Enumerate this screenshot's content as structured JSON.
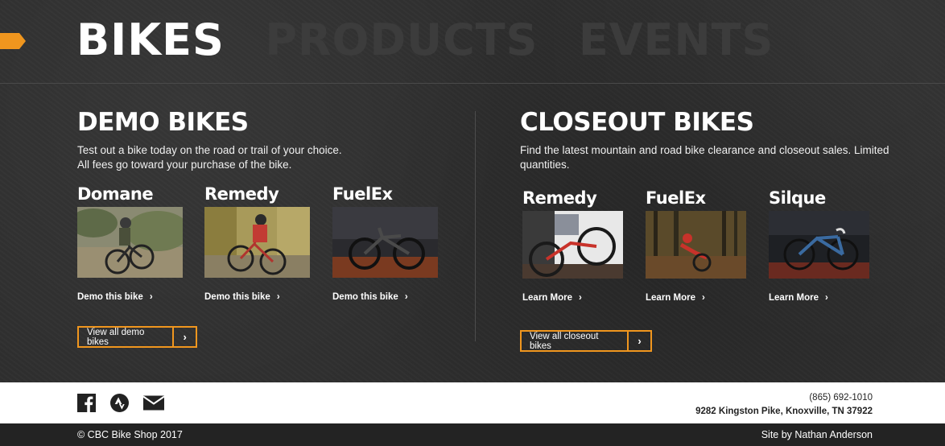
{
  "nav": {
    "tabs": [
      {
        "label": "BIKES",
        "active": true
      },
      {
        "label": "PRODUCTS",
        "active": false
      },
      {
        "label": "EVENTS",
        "active": false
      }
    ],
    "marker_color": "#f0961e"
  },
  "demo": {
    "title": "DEMO BIKES",
    "desc_line1": "Test out a bike today on the road or trail of your choice.",
    "desc_line2": "All fees go toward your purchase of the bike.",
    "bikes": [
      {
        "name": "Domane",
        "link": "Demo this bike"
      },
      {
        "name": "Remedy",
        "link": "Demo this bike"
      },
      {
        "name": "FuelEx",
        "link": "Demo this bike"
      }
    ],
    "view_all": "View all demo bikes"
  },
  "closeout": {
    "title": "CLOSEOUT BIKES",
    "desc_line1": "Find the latest mountain and road bike clearance and closeout sales. Limited",
    "desc_line2": "quantities.",
    "bikes": [
      {
        "name": "Remedy",
        "link": "Learn More"
      },
      {
        "name": "FuelEx",
        "link": "Learn More"
      },
      {
        "name": "Silque",
        "link": "Learn More"
      }
    ],
    "view_all": "View all closeout bikes"
  },
  "footer": {
    "social": [
      "facebook-icon",
      "strava-icon",
      "email-icon"
    ],
    "phone": "(865) 692-1010",
    "address": "9282 Kingston Pike, Knoxville, TN 37922",
    "copyright": "© CBC Bike Shop 2017",
    "credit": "Site by Nathan Anderson"
  },
  "colors": {
    "accent": "#f0961e",
    "background": "#2f2f2f",
    "inactive_tab": "#3c3c3c"
  }
}
